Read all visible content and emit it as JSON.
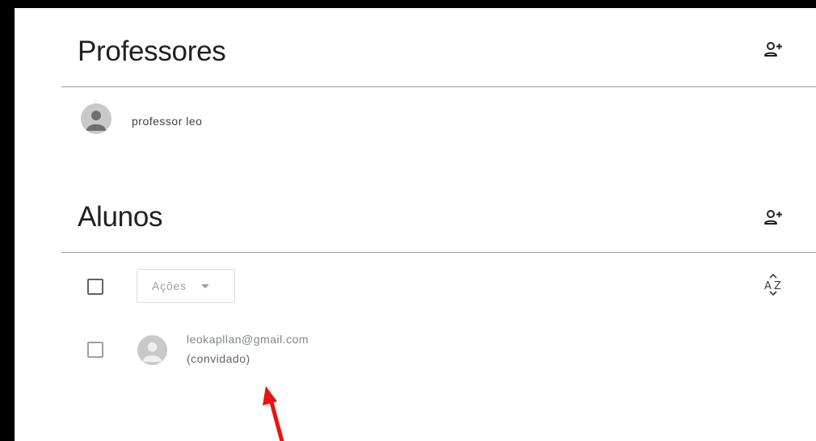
{
  "teachers": {
    "title": "Professores",
    "add_icon": "person-add-icon",
    "items": [
      {
        "name": "professor leo",
        "avatar_icon": "person-icon"
      }
    ]
  },
  "students": {
    "title": "Alunos",
    "add_icon": "person-add-icon",
    "actions_label": "Ações",
    "sort_icon": "sort-az-icon",
    "items": [
      {
        "email": "leokapllan@gmail.com",
        "status": "(convidado)",
        "avatar_icon": "person-icon"
      }
    ]
  },
  "colors": {
    "frame": "#000000",
    "annotation_arrow": "#ee1111",
    "divider": "#9e9e9e",
    "avatar": "#c9c9c9"
  }
}
